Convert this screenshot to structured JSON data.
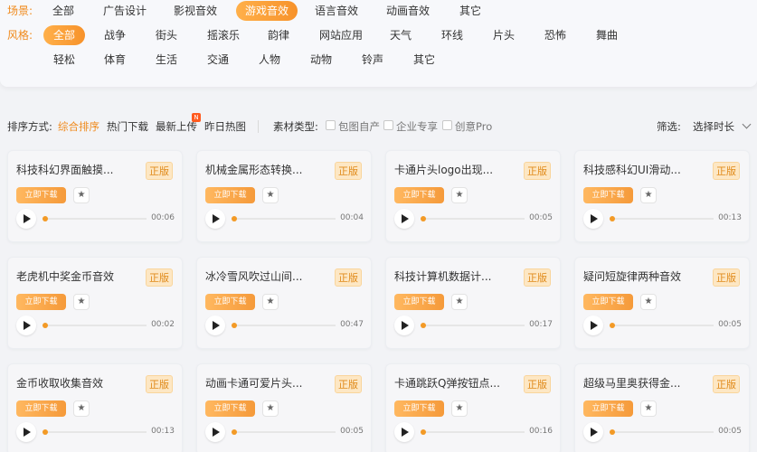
{
  "filters": {
    "scene_label": "场景:",
    "scene_items": [
      "全部",
      "广告设计",
      "影视音效",
      "游戏音效",
      "语言音效",
      "动画音效",
      "其它"
    ],
    "style_label": "风格:",
    "style_row1": [
      "全部",
      "战争",
      "街头",
      "摇滚乐",
      "韵律",
      "网站应用",
      "天气",
      "环线",
      "片头",
      "恐怖",
      "舞曲"
    ],
    "style_row2": [
      "轻松",
      "体育",
      "生活",
      "交通",
      "人物",
      "动物",
      "铃声",
      "其它"
    ],
    "active_scene": "游戏音效",
    "active_style": "全部"
  },
  "sortbar": {
    "sort_label": "排序方式:",
    "sort_options": [
      "综合排序",
      "热门下载",
      "最新上传",
      "昨日热图"
    ],
    "new_badge": "N",
    "type_label": "素材类型:",
    "type_options": [
      "包图自产",
      "企业专享",
      "创意Pro"
    ],
    "filter_label": "筛选:",
    "filter_value": "选择时长"
  },
  "card_labels": {
    "licence": "正版",
    "download": "立即下载"
  },
  "cards": [
    {
      "title": "科技科幻界面触摸...",
      "duration": "00:06"
    },
    {
      "title": "机械金属形态转换...",
      "duration": "00:04"
    },
    {
      "title": "卡通片头logo出现...",
      "duration": "00:05"
    },
    {
      "title": "科技感科幻UI滑动...",
      "duration": "00:13"
    },
    {
      "title": "老虎机中奖金币音效",
      "duration": "00:02"
    },
    {
      "title": "冰冷雪风吹过山间...",
      "duration": "00:47"
    },
    {
      "title": "科技计算机数据计...",
      "duration": "00:17"
    },
    {
      "title": "疑问短旋律两种音效",
      "duration": "00:05"
    },
    {
      "title": "金币收取收集音效",
      "duration": "00:13"
    },
    {
      "title": "动画卡通可爱片头...",
      "duration": "00:05"
    },
    {
      "title": "卡通跳跃Q弹按钮点...",
      "duration": "00:16"
    },
    {
      "title": "超级马里奥获得金...",
      "duration": "00:05"
    }
  ],
  "colors": {
    "accent": "#f08a1c",
    "accent_gradient_end": "#f7922a",
    "licence_bg": "#fde7c4"
  },
  "icons": {
    "favorite": "star-icon",
    "play": "play-icon",
    "dropdown": "chevron-down-icon"
  }
}
